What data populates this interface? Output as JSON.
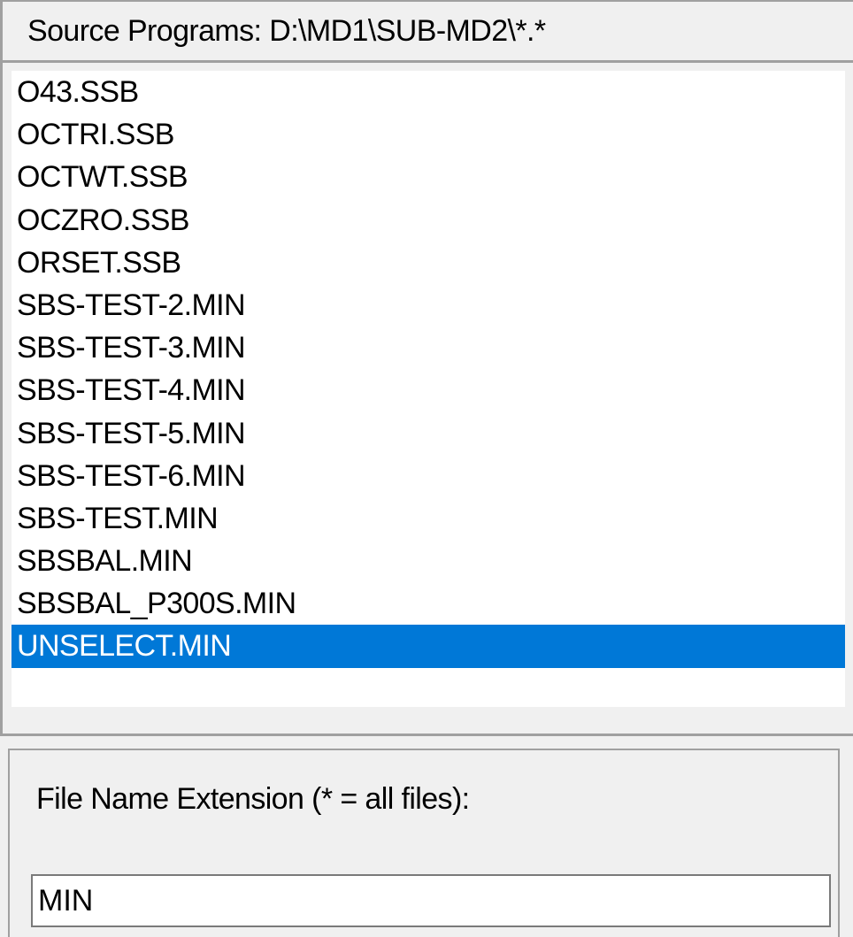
{
  "header": {
    "title": "Source Programs: D:\\MD1\\SUB-MD2\\*.*"
  },
  "file_list": {
    "items": [
      "O43.SSB",
      "OCTRI.SSB",
      "OCTWT.SSB",
      "OCZRO.SSB",
      "ORSET.SSB",
      "SBS-TEST-2.MIN",
      "SBS-TEST-3.MIN",
      "SBS-TEST-4.MIN",
      "SBS-TEST-5.MIN",
      "SBS-TEST-6.MIN",
      "SBS-TEST.MIN",
      "SBSBAL.MIN",
      "SBSBAL_P300S.MIN",
      "UNSELECT.MIN"
    ],
    "selected": "UNSELECT.MIN",
    "selection_color": "#0078d7"
  },
  "extension": {
    "label": "File Name Extension (* = all files):",
    "value": "MIN"
  }
}
